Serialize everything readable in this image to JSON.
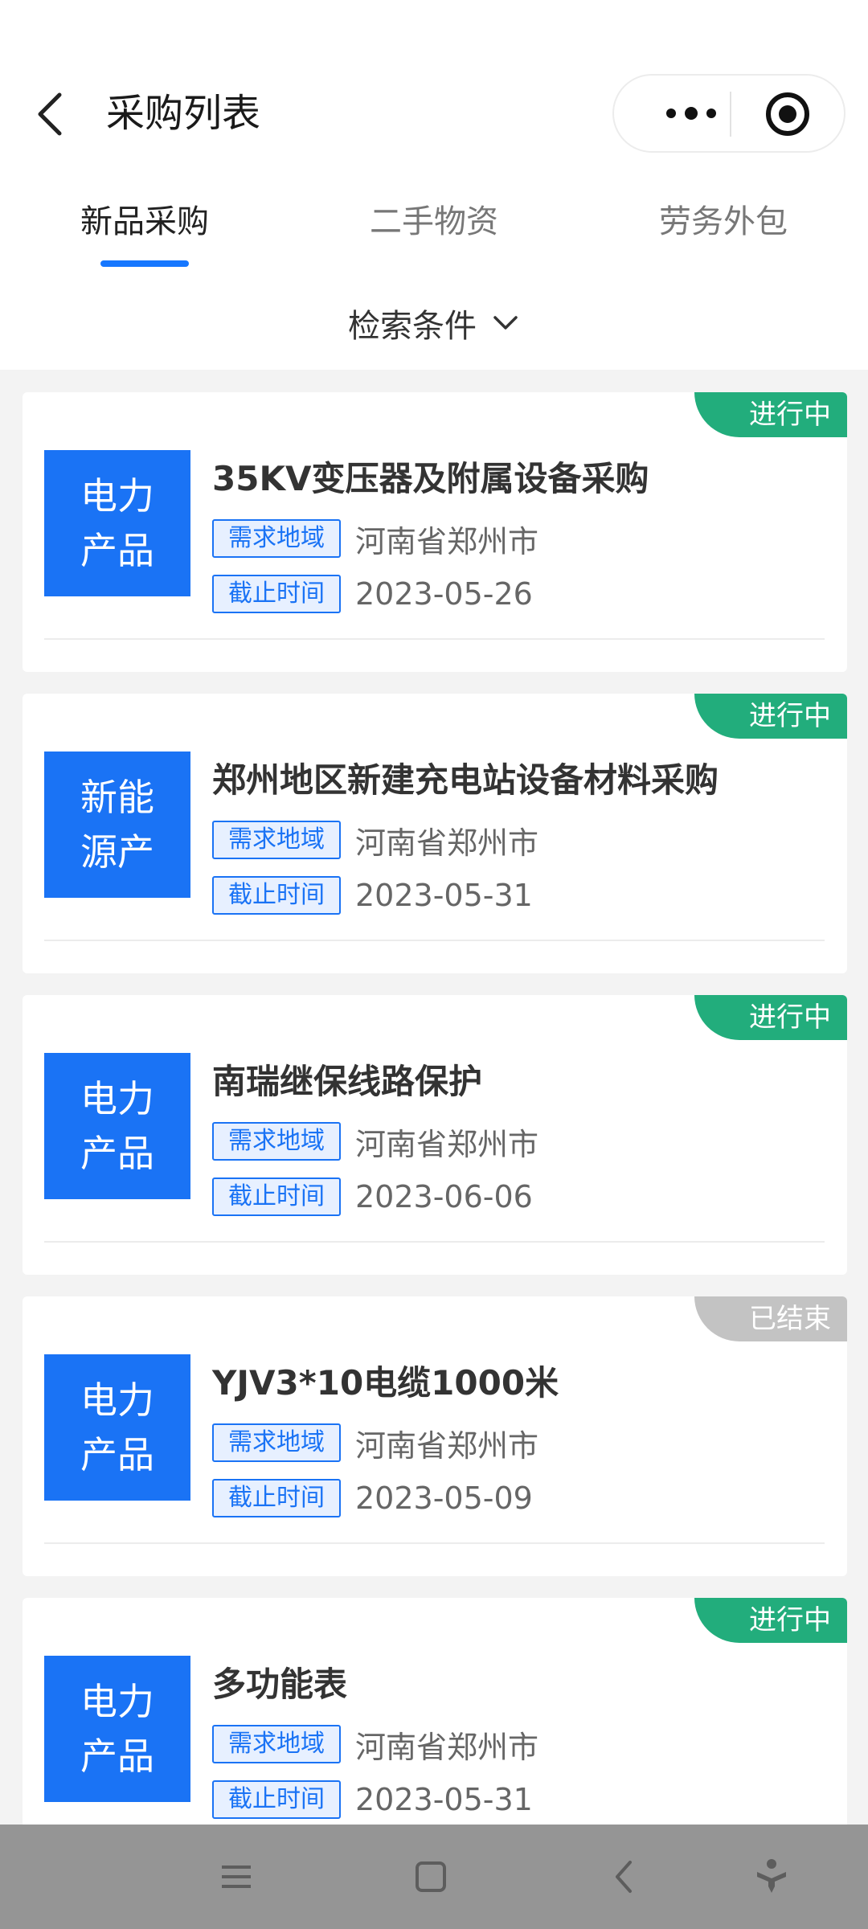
{
  "header": {
    "title": "采购列表",
    "back_icon": "chevron-left-icon",
    "more_icon": "more-dots-icon",
    "target_icon": "target-icon"
  },
  "tabs": [
    {
      "label": "新品采购",
      "active": true
    },
    {
      "label": "二手物资",
      "active": false
    },
    {
      "label": "劳务外包",
      "active": false
    }
  ],
  "filter": {
    "label": "检索条件",
    "icon": "chevron-down-icon"
  },
  "labels": {
    "region": "需求地域",
    "deadline": "截止时间"
  },
  "colors": {
    "accent": "#1677ff",
    "category_bg": "#1a73f5",
    "ongoing": "#22ad7c",
    "ended": "#c3c3c3"
  },
  "items": [
    {
      "category": "电力产品",
      "status": "进行中",
      "title": "35KV变压器及附属设备采购",
      "region": "河南省郑州市",
      "deadline": "2023-05-26"
    },
    {
      "category": "新能源产",
      "status": "进行中",
      "title": "郑州地区新建充电站设备材料采购",
      "region": "河南省郑州市",
      "deadline": "2023-05-31"
    },
    {
      "category": "电力产品",
      "status": "进行中",
      "title": "南瑞继保线路保护",
      "region": "河南省郑州市",
      "deadline": "2023-06-06"
    },
    {
      "category": "电力产品",
      "status": "已结束",
      "title": "YJV3*10电缆1000米",
      "region": "河南省郑州市",
      "deadline": "2023-05-09"
    },
    {
      "category": "电力产品",
      "status": "进行中",
      "title": "多功能表",
      "region": "河南省郑州市",
      "deadline": "2023-05-31"
    }
  ],
  "system_nav": [
    "menu-icon",
    "home-square-icon",
    "back-triangle-icon",
    "accessibility-icon"
  ]
}
